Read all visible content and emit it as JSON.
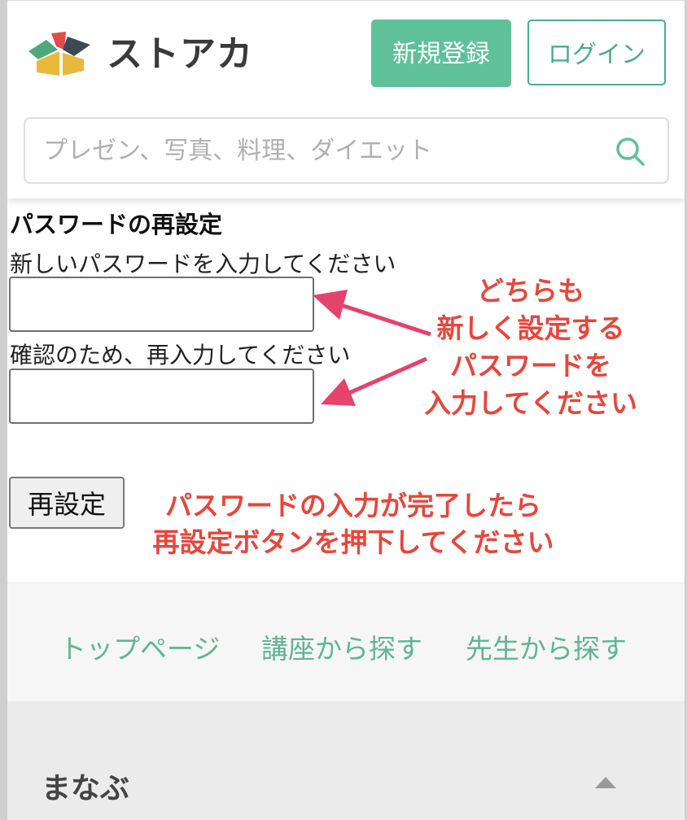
{
  "header": {
    "logo_text": "ストアカ",
    "signup_label": "新規登録",
    "login_label": "ログイン",
    "search": {
      "placeholder": "プレゼン、写真、料理、ダイエット",
      "value": ""
    }
  },
  "form": {
    "title": "パスワードの再設定",
    "new_password_label": "新しいパスワードを入力してください",
    "confirm_label": "確認のため、再入力してください",
    "new_password_value": "",
    "confirm_value": "",
    "submit_label": "再設定"
  },
  "annotations": {
    "note1": [
      "どちらも",
      "新しく設定する",
      "パスワードを",
      "入力してください"
    ],
    "note2": [
      "パスワードの入力が完了したら",
      "再設定ボタンを押下してください"
    ]
  },
  "footer": {
    "links": [
      "トップページ",
      "講座から探す",
      "先生から探す"
    ],
    "section_title": "まなぶ"
  },
  "colors": {
    "brand_green": "#5fc19a",
    "annotation_red": "#e8463b",
    "arrow_pink": "#e5436b"
  },
  "icons": [
    "search-icon",
    "caret-up-icon",
    "logo-icon"
  ]
}
